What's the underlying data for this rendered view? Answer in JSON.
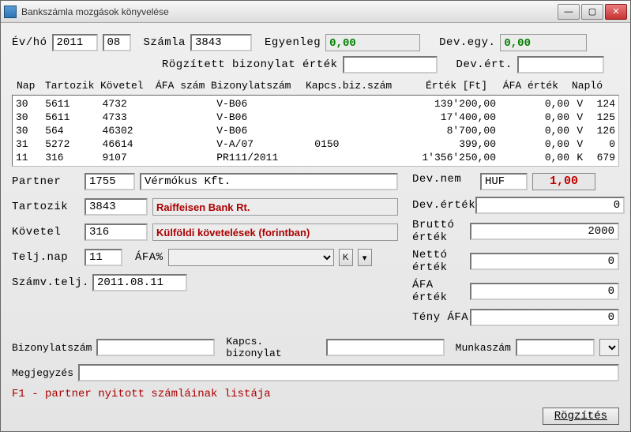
{
  "window": {
    "title": "Bankszámla mozgások könyvelése"
  },
  "header": {
    "year_label": "Év/hó",
    "year": "2011",
    "month": "08",
    "account_label": "Számla",
    "account": "3843",
    "balance_label": "Egyenleg",
    "balance": "0,00",
    "dev_unit_label": "Dev.egy.",
    "dev_unit": "0,00",
    "recorded_label": "Rögzített bizonylat érték",
    "recorded_value": "",
    "dev_value_label": "Dev.ért.",
    "dev_value": ""
  },
  "grid": {
    "cols": {
      "nap": "Nap",
      "tartozik": "Tartozik",
      "kovetel": "Követel",
      "afa": "ÁFA szám",
      "biz": "Bizonylatszám",
      "kapcs": "Kapcs.biz.szám",
      "ertek": "Érték [Ft]",
      "afaertek": "ÁFA érték",
      "naplo": "Napló"
    },
    "rows": [
      {
        "nap": "30",
        "tartozik": "5611",
        "kovetel": "4732",
        "afa": "",
        "biz": "V-B06",
        "kapcs": "",
        "ertek": "139'200,00",
        "afaertek": "0,00",
        "naplo1": "V",
        "naplo2": "124"
      },
      {
        "nap": "30",
        "tartozik": "5611",
        "kovetel": "4733",
        "afa": "",
        "biz": "V-B06",
        "kapcs": "",
        "ertek": "17'400,00",
        "afaertek": "0,00",
        "naplo1": "V",
        "naplo2": "125"
      },
      {
        "nap": "30",
        "tartozik": "564",
        "kovetel": "46302",
        "afa": "",
        "biz": "V-B06",
        "kapcs": "",
        "ertek": "8'700,00",
        "afaertek": "0,00",
        "naplo1": "V",
        "naplo2": "126"
      },
      {
        "nap": "31",
        "tartozik": "5272",
        "kovetel": "46614",
        "afa": "",
        "biz": "V-A/07",
        "kapcs": "0150",
        "ertek": "399,00",
        "afaertek": "0,00",
        "naplo1": "V",
        "naplo2": "0"
      },
      {
        "nap": "11",
        "tartozik": "316",
        "kovetel": "9107",
        "afa": "",
        "biz": "PR111/2011",
        "kapcs": "",
        "ertek": "1'356'250,00",
        "afaertek": "0,00",
        "naplo1": "K",
        "naplo2": "679"
      }
    ]
  },
  "partner": {
    "label": "Partner",
    "code": "1755",
    "name": "Vérmókus Kft.",
    "devnem_label": "Dev.nem",
    "devnem": "HUF",
    "devrate": "1,00"
  },
  "debit": {
    "label": "Tartozik",
    "code": "3843",
    "name": "Raiffeisen Bank Rt."
  },
  "credit": {
    "label": "Követel",
    "code": "316",
    "name": "Külföldi követelések (forintban)"
  },
  "telj": {
    "label": "Telj.nap",
    "value": "11",
    "afa_label": "ÁFA%",
    "afa_combo": "",
    "k_label": "K"
  },
  "szamv": {
    "label": "Számv.telj.",
    "value": "2011.08.11"
  },
  "right": {
    "devertek_label": "Dev.érték",
    "devertek": "0",
    "brutto_label": "Bruttó érték",
    "brutto": "2000",
    "netto_label": "Nettó érték",
    "netto": "0",
    "afaertek_label": "ÁFA érték",
    "afaertek": "0",
    "tenyafa_label": "Tény ÁFA",
    "tenyafa": "0"
  },
  "bottom": {
    "biz_label": "Bizonylatszám",
    "biz": "",
    "kapcs_label": "Kapcs. bizonylat",
    "kapcs": "",
    "munka_label": "Munkaszám",
    "munka": "",
    "megj_label": "Megjegyzés",
    "megj": ""
  },
  "hint": "F1 - partner nyitott számláinak listája",
  "record_btn": "Rögzítés"
}
